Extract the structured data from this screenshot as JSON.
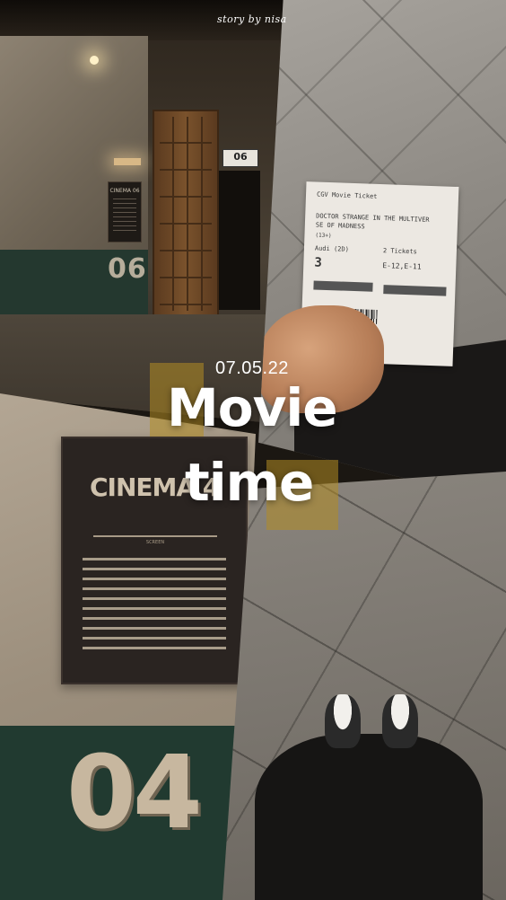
{
  "credit": "story by nisa",
  "date": "07.05.22",
  "title": {
    "line1": "Movie",
    "line2": "time"
  },
  "corridor_panel": {
    "room_number": "06",
    "door_plate": "06",
    "room_sign": "CINEMA 06"
  },
  "ticket_panel": {
    "header": "CGV Movie Ticket",
    "movie_line1": "DOCTOR STRANGE IN THE MULTIVER",
    "movie_line2": "SE OF MADNESS",
    "rating": "(13+)",
    "auditorium": "Audi (2D)",
    "auditorium_number": "3",
    "tickets": "2 Tickets",
    "seats": "E-12,E-11"
  },
  "sign_panel": {
    "title": "CINEMA 4",
    "screen_label": "SCREEN",
    "room_number": "04"
  },
  "colors": {
    "accent_mustard": "#b28c23",
    "wall_green": "#213a30",
    "text": "#ffffff"
  }
}
